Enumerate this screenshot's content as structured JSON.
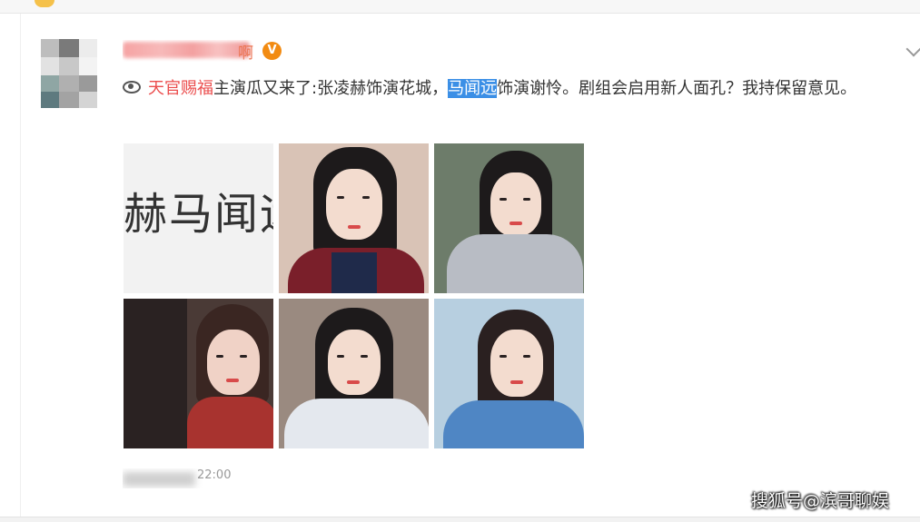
{
  "post": {
    "username_suffix": "啊",
    "verified_badge": "V",
    "topic": "天官赐福",
    "text_before": "主演瓜又来了:张凌赫饰演花城，",
    "highlighted": "马闻远",
    "text_after": "饰演谢怜。剧组会启用新人面孔？我持保留意见。",
    "timestamp_tail": "22:00",
    "image_text": "赫马闻远"
  },
  "watermark": "搜狐号@滨哥聊娱",
  "icons": [
    "topic-icon",
    "verified-icon",
    "chevron-down-icon"
  ],
  "colors": {
    "topic": "#eb4d4d",
    "highlight": "#3b8fe6",
    "badge": "#f28b12"
  }
}
